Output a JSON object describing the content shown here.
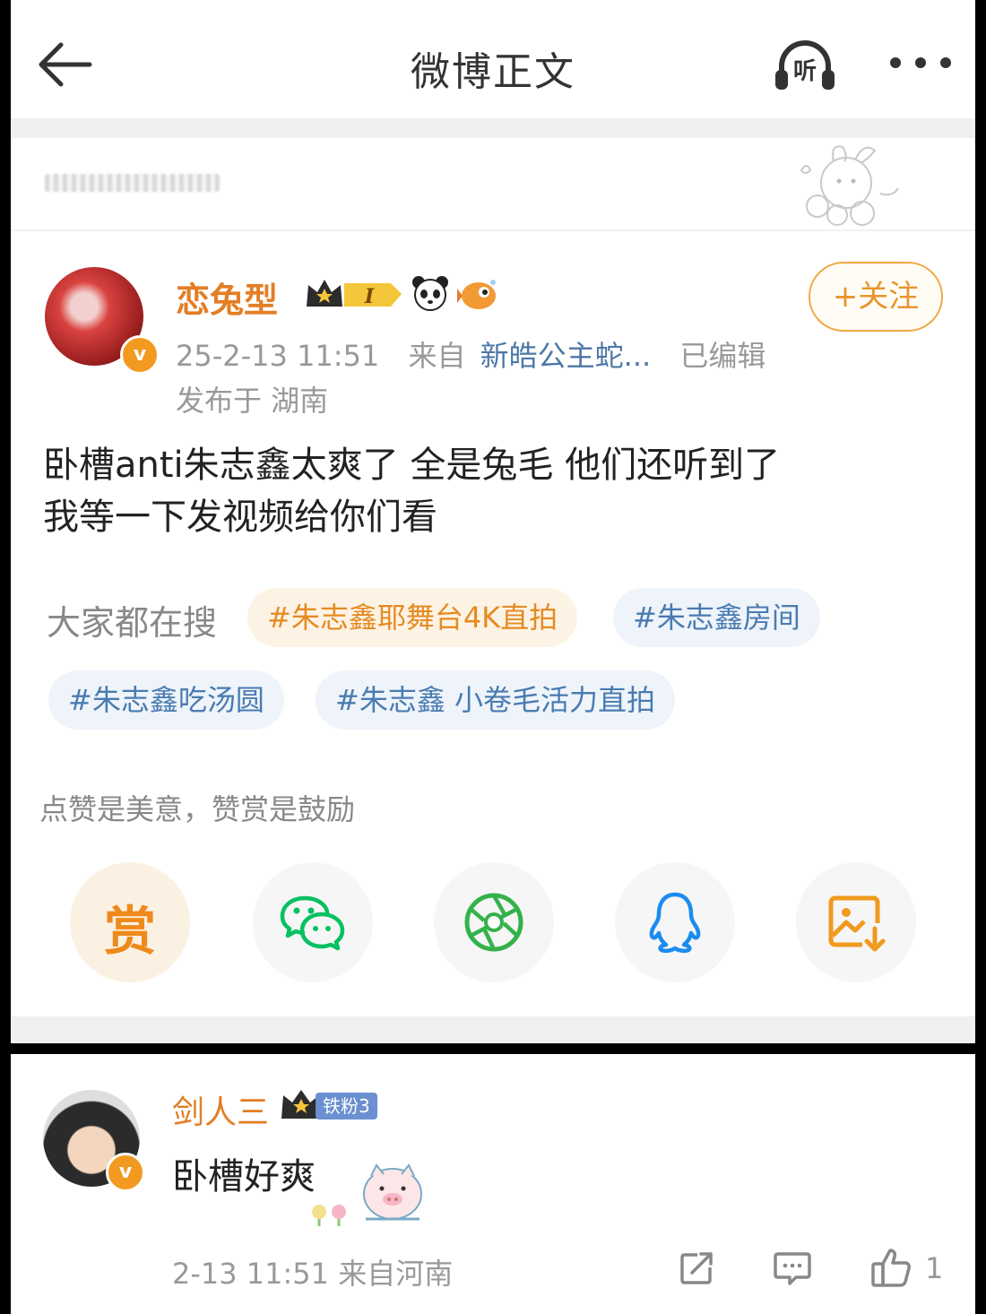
{
  "nav": {
    "title": "微博正文",
    "listen_label": "听"
  },
  "post": {
    "author": "恋兔型",
    "crown_level": "I",
    "follow_label": "+关注",
    "time": "25-2-13 11:51",
    "from_label": "来自",
    "source": "新皓公主蛇...",
    "edited": "已编辑",
    "location": "发布于 湖南",
    "content_line1": "卧槽anti朱志鑫太爽了 全是兔毛 他们还听到了",
    "content_line2": "我等一下发视频给你们看"
  },
  "hot_search": {
    "label": "大家都在搜",
    "tags": [
      "#朱志鑫耶舞台4K直拍",
      "#朱志鑫房间",
      "#朱志鑫吃汤圆",
      "#朱志鑫 小卷毛活力直拍"
    ]
  },
  "reward": {
    "caption": "点赞是美意，赞赏是鼓励",
    "reward_char": "赏"
  },
  "comment": {
    "author": "剑人三",
    "fan_badge": "铁粉3",
    "text": "卧槽好爽",
    "meta": "2-13 11:51  来自河南",
    "like_count": "1"
  },
  "colors": {
    "accent": "#e27e24",
    "link": "#4d77a6",
    "wechat": "#07c160"
  }
}
